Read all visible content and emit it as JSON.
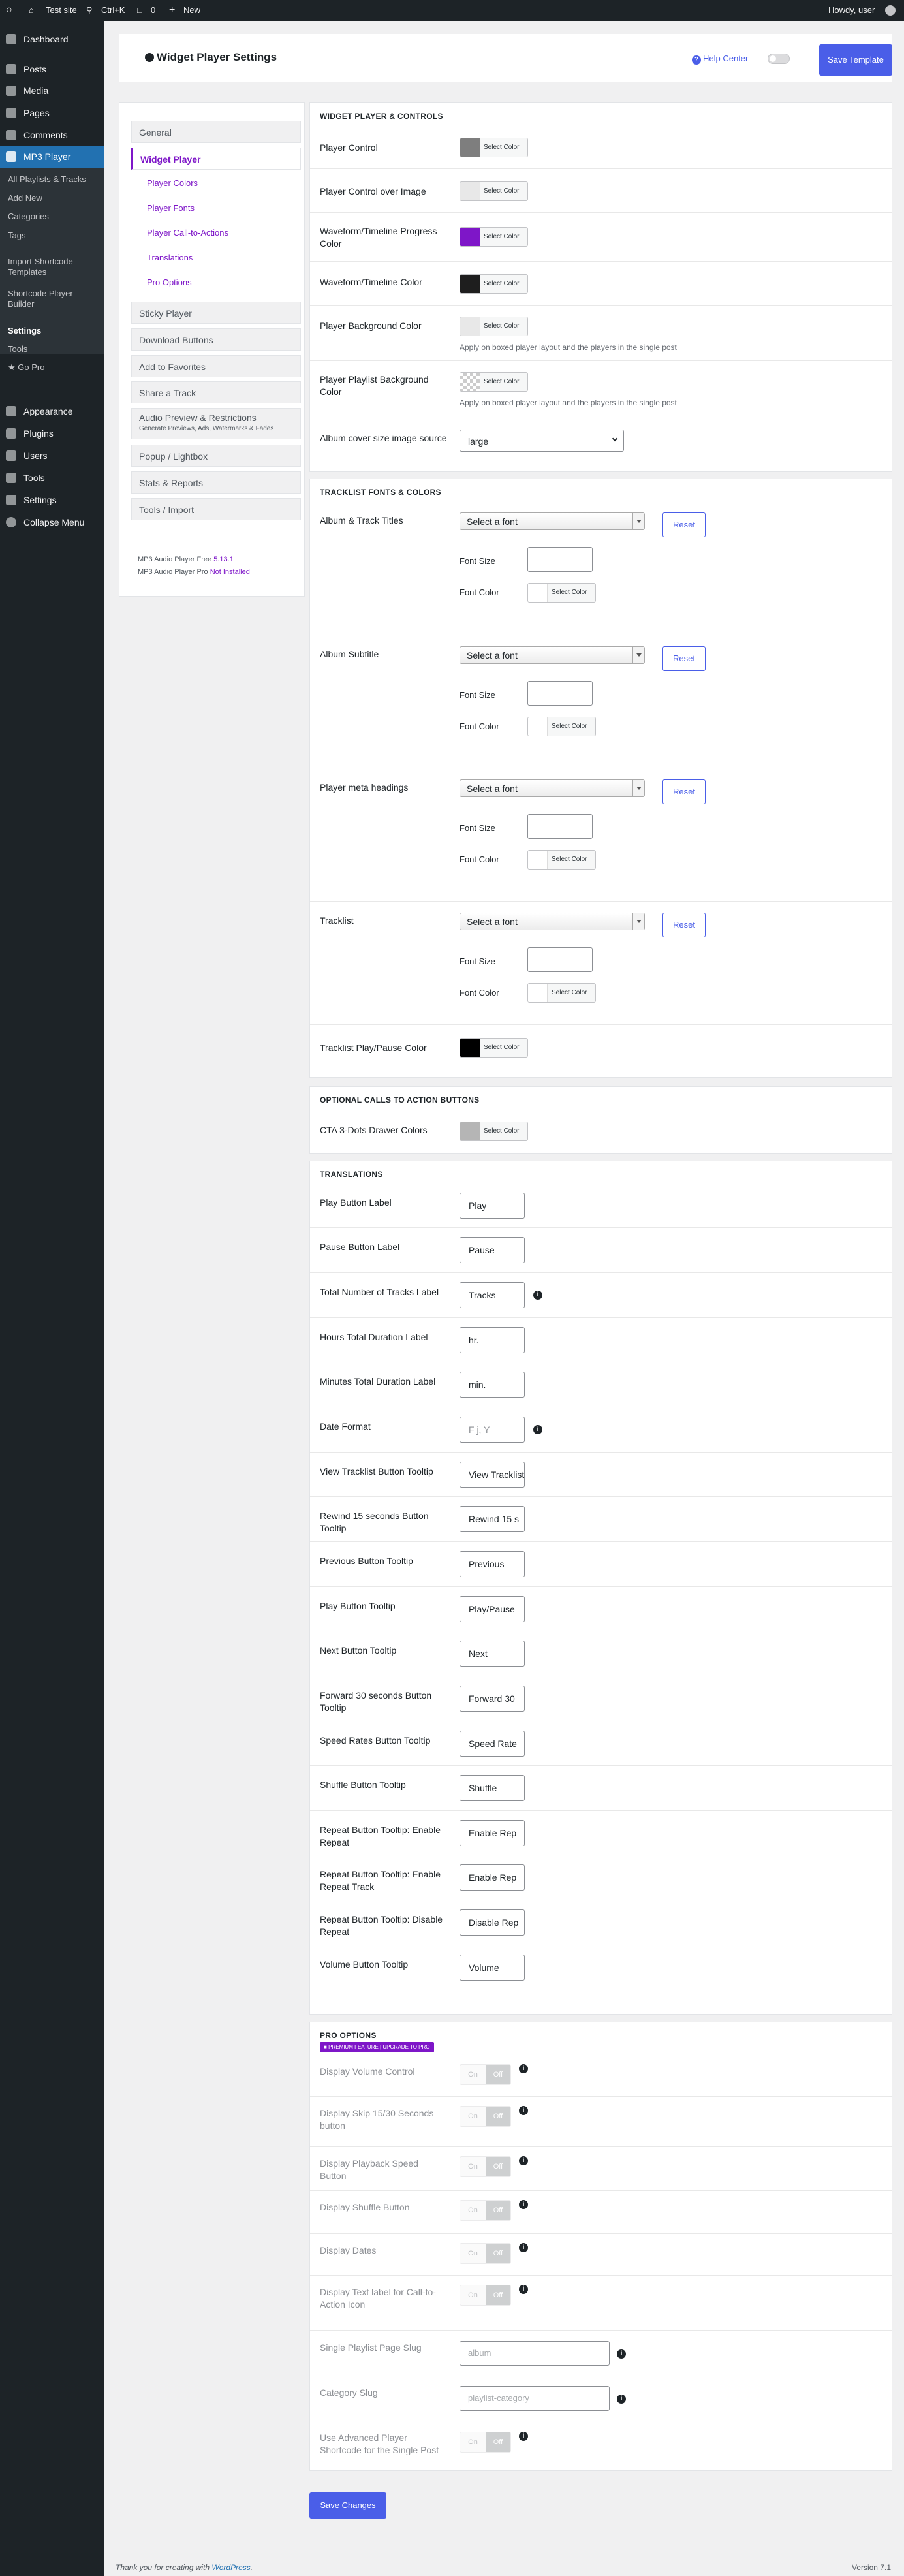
{
  "admin_bar": {
    "site": "Test site",
    "search": "Ctrl+K",
    "comments": "0",
    "new": "New",
    "howdy": "Howdy, user"
  },
  "sidebar": {
    "dashboard": "Dashboard",
    "posts": "Posts",
    "media": "Media",
    "pages": "Pages",
    "comments": "Comments",
    "mp3": "MP3 Player",
    "sub": [
      "All Playlists & Tracks",
      "Add New",
      "Categories",
      "Tags",
      "Import Shortcode Templates",
      "Shortcode Player Builder",
      "Settings",
      "Tools",
      "Go Pro"
    ],
    "appearance": "Appearance",
    "plugins": "Plugins",
    "users": "Users",
    "tools": "Tools",
    "settings": "Settings",
    "collapse": "Collapse Menu"
  },
  "header": {
    "title": "Widget Player Settings",
    "help": "Help Center",
    "save_template": "Save Template"
  },
  "nav": {
    "general": "General",
    "widget_player": "Widget Player",
    "subs": [
      "Player Colors",
      "Player Fonts",
      "Player Call-to-Actions",
      "Translations",
      "Pro Options"
    ],
    "sticky": "Sticky Player",
    "download": "Download Buttons",
    "share": "Share a Track",
    "favorites": "Add to Favorites",
    "audio_preview": "Audio Preview & Restrictions",
    "audio_preview_desc": "Generate Previews, Ads, Watermarks & Fades",
    "popup": "Popup / Lightbox",
    "stats": "Stats & Reports",
    "tools": "Tools / Import",
    "free_label": "MP3 Audio Player Free",
    "free_version": "5.13.1",
    "pro_label": "MP3 Audio Player Pro",
    "pro_status": "Not Installed"
  },
  "colors": {
    "dark_gray": "#7e7e7e",
    "light_gray": "#e8e8e8",
    "purple": "#7e16c8",
    "near_black": "#1e1e1e",
    "black": "#000000",
    "cta_gray": "#b5b5b5",
    "accent": "#4a5ee8"
  },
  "select_color": "Select Color",
  "controls": {
    "title": "WIDGET PLAYER & CONTROLS",
    "player_control": "Player Control",
    "player_control_image": "Player Control over Image",
    "waveform_progress": "Waveform/Timeline Progress Color",
    "waveform_color": "Waveform/Timeline Color",
    "bg_color": "Player Background Color",
    "bg_hint": "Apply on boxed player layout and the players in the single post",
    "playlist_bg": "Player Playlist Background Color",
    "playlist_bg_hint": "Apply on boxed player layout and the players in the single post",
    "album_cover": "Album cover size image source",
    "album_cover_value": "large"
  },
  "fonts": {
    "title": "TRACKLIST FONTS & COLORS",
    "select_font": "Select a font",
    "reset": "Reset",
    "font_size": "Font Size",
    "font_color": "Font Color",
    "groups": [
      "Album & Track Titles",
      "Album Subtitle",
      "Player meta headings",
      "Tracklist"
    ],
    "play_pause": "Tracklist Play/Pause Color"
  },
  "cta": {
    "title": "OPTIONAL CALLS TO ACTION BUTTONS",
    "drawer": "CTA 3-Dots Drawer Colors"
  },
  "translations": {
    "title": "TRANSLATIONS",
    "rows": [
      {
        "label": "Play Button Label",
        "value": "Play"
      },
      {
        "label": "Pause Button Label",
        "value": "Pause"
      },
      {
        "label": "Total Number of Tracks Label",
        "value": "Tracks"
      },
      {
        "label": "Hours Total Duration Label",
        "value": "hr."
      },
      {
        "label": "Minutes Total Duration Label",
        "value": "min."
      },
      {
        "label": "Date Format",
        "value": "F j, Y"
      },
      {
        "label": "View Tracklist Button Tooltip",
        "value": "View Tracklist"
      },
      {
        "label": "Rewind 15 seconds Button Tooltip",
        "value": "Rewind 15 s"
      },
      {
        "label": "Previous Button Tooltip",
        "value": "Previous"
      },
      {
        "label": "Play Button Tooltip",
        "value": "Play/Pause"
      },
      {
        "label": "Next Button Tooltip",
        "value": "Next"
      },
      {
        "label": "Forward 30 seconds Button Tooltip",
        "value": "Forward 30"
      },
      {
        "label": "Speed Rates Button Tooltip",
        "value": "Speed Rate"
      },
      {
        "label": "Shuffle Button Tooltip",
        "value": "Shuffle"
      },
      {
        "label": "Repeat Button Tooltip: Enable Repeat",
        "value": "Enable Rep"
      },
      {
        "label": "Repeat Button Tooltip: Enable Repeat Track",
        "value": "Enable Rep"
      },
      {
        "label": "Repeat Button Tooltip: Disable Repeat",
        "value": "Disable Rep"
      },
      {
        "label": "Volume Button Tooltip",
        "value": "Volume"
      }
    ]
  },
  "pro": {
    "title": "PRO OPTIONS",
    "badge": "PREMIUM FEATURE | UPGRADE TO PRO",
    "on": "On",
    "off": "Off",
    "toggles": [
      "Display Volume Control",
      "Display Skip 15/30 Seconds button",
      "Display Playback Speed Button",
      "Display Shuffle Button",
      "Display Dates",
      "Display Text label for Call-to-Action Icon"
    ],
    "playlist_slug": "Single Playlist Page Slug",
    "playlist_slug_ph": "album",
    "category_slug": "Category Slug",
    "category_slug_ph": "playlist-category",
    "advanced": "Use Advanced Player Shortcode for the Single Post"
  },
  "save_changes": "Save Changes",
  "footer": {
    "thanks": "Thank you for creating with",
    "wp": "WordPress",
    "version": "Version 7.1"
  }
}
